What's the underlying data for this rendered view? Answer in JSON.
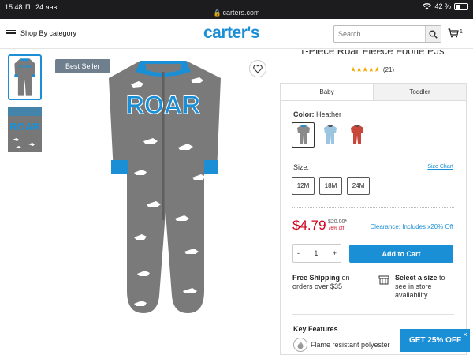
{
  "status_bar": {
    "time": "15:48",
    "date": "Пт 24 янв.",
    "url": "carters.com",
    "battery": "42 %",
    "battery_level": 0.42
  },
  "header": {
    "menu_label": "Shop By category",
    "logo": "carter's",
    "search_placeholder": "Search",
    "cart_count": "1"
  },
  "gallery": {
    "badge": "Best Seller",
    "thumbnails": [
      "front view",
      "back view"
    ]
  },
  "product": {
    "title": "1-Piece Roar Fleece Footie PJs",
    "stars": "★★★★★",
    "reviews": "(21)",
    "rating_stars": 5,
    "garment_text": "ROAR"
  },
  "panel": {
    "tabs": [
      "Baby",
      "Toddler"
    ],
    "color_label": "Color:",
    "color_value": "Heather",
    "swatches": [
      {
        "name": "heather",
        "color": "#8a8a8a"
      },
      {
        "name": "blue",
        "color": "#9cc5e0"
      },
      {
        "name": "red",
        "color": "#c9463b"
      }
    ],
    "size_label": "Size:",
    "size_chart": "Size Chart",
    "sizes": [
      "12M",
      "18M",
      "24M"
    ],
    "price": "$4.79",
    "old_price": "$20.00*",
    "off": "76% off",
    "clearance": "Clearance: Includes x20% Off",
    "qty_minus": "-",
    "qty_value": "1",
    "qty_plus": "+",
    "add_to_cart": "Add to Cart",
    "shipping_bold": "Free Shipping",
    "shipping_rest": " on orders over $35",
    "store_bold": "Select a size",
    "store_rest": " to see in store availability",
    "key_features": "Key Features",
    "feature_1": "Flame resistant polyester"
  },
  "promo": {
    "label": "GET 25% OFF",
    "close": "×"
  },
  "colors": {
    "brand_blue": "#1b8fd6",
    "price_red": "#d0021b",
    "star_gold": "#f2a900"
  }
}
